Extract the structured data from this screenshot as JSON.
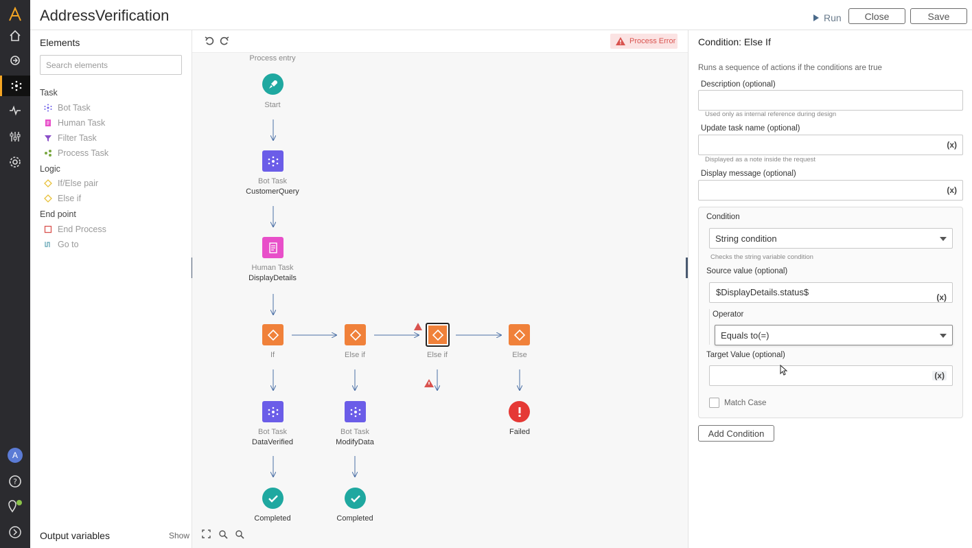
{
  "app": {
    "title": "AddressVerification"
  },
  "header": {
    "run_label": "Run",
    "close_label": "Close",
    "save_label": "Save"
  },
  "elements_panel": {
    "title": "Elements",
    "search_placeholder": "Search elements",
    "categories": [
      {
        "label": "Task",
        "items": [
          "Bot Task",
          "Human Task",
          "Filter Task",
          "Process Task"
        ]
      },
      {
        "label": "Logic",
        "items": [
          "If/Else pair",
          "Else if"
        ]
      },
      {
        "label": "End point",
        "items": [
          "End Process",
          "Go to"
        ]
      }
    ],
    "output_variables": "Output variables",
    "show_label": "Show"
  },
  "canvas": {
    "process_error": "Process Error",
    "process_entry": "Process entry",
    "nodes": {
      "start": {
        "name": "Start"
      },
      "bot1": {
        "type": "Bot Task",
        "name": "CustomerQuery"
      },
      "human": {
        "type": "Human Task",
        "name": "DisplayDetails"
      },
      "if": {
        "name": "If"
      },
      "elseif1": {
        "name": "Else if"
      },
      "elseif2": {
        "name": "Else if"
      },
      "else": {
        "name": "Else"
      },
      "bot2": {
        "type": "Bot Task",
        "name": "DataVerified"
      },
      "bot3": {
        "type": "Bot Task",
        "name": "ModifyData"
      },
      "failed": {
        "name": "Failed"
      },
      "completed1": {
        "name": "Completed"
      },
      "completed2": {
        "name": "Completed"
      }
    }
  },
  "properties": {
    "title": "Condition: Else If",
    "description": "Runs a sequence of actions if the conditions are true",
    "description_label": "Description (optional)",
    "description_hint": "Used only as internal reference during design",
    "update_task_label": "Update task name (optional)",
    "update_task_hint": "Displayed as a note inside the request",
    "display_message_label": "Display message (optional)",
    "variable_button": "(x)",
    "condition": {
      "label": "Condition",
      "selected": "String condition",
      "hint": "Checks the string variable condition",
      "source_label": "Source value (optional)",
      "source_value": "$DisplayDetails.status$",
      "operator_label": "Operator",
      "operator_selected": "Equals to(=)",
      "target_label": "Target Value (optional)",
      "match_case_label": "Match Case"
    },
    "add_condition_label": "Add Condition"
  },
  "colors": {
    "bot": "#6b5de8",
    "human": "#e84fc9",
    "logic": "#f0813a",
    "start": "#1fa8a0",
    "failed": "#e53935",
    "rail": "#2b2b2f",
    "accent": "#f5a623"
  }
}
